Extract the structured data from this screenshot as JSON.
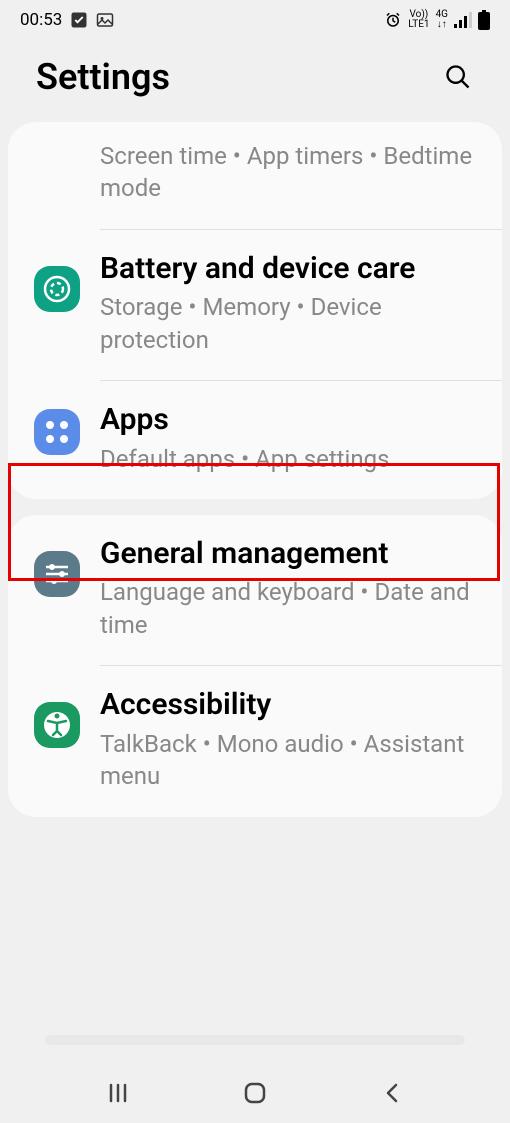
{
  "statusbar": {
    "time": "00:53",
    "volte": "Vo))",
    "lte": "LTE1",
    "net": "4G"
  },
  "header": {
    "title": "Settings"
  },
  "card1": {
    "digital_wellbeing": {
      "sub": "Screen time  •  App timers  •  Bedtime mode"
    },
    "battery": {
      "title": "Battery and device care",
      "sub": "Storage  •  Memory  •  Device protection"
    },
    "apps": {
      "title": "Apps",
      "sub": "Default apps  •  App settings"
    }
  },
  "card2": {
    "general": {
      "title": "General management",
      "sub": "Language and keyboard  •  Date and time"
    },
    "accessibility": {
      "title": "Accessibility",
      "sub": "TalkBack  •  Mono audio  •  Assistant menu"
    }
  },
  "colors": {
    "battery_icon": "#0fa184",
    "apps_icon": "#5b8de8",
    "general_icon": "#5b7a8a",
    "accessibility_icon": "#1a9960"
  }
}
